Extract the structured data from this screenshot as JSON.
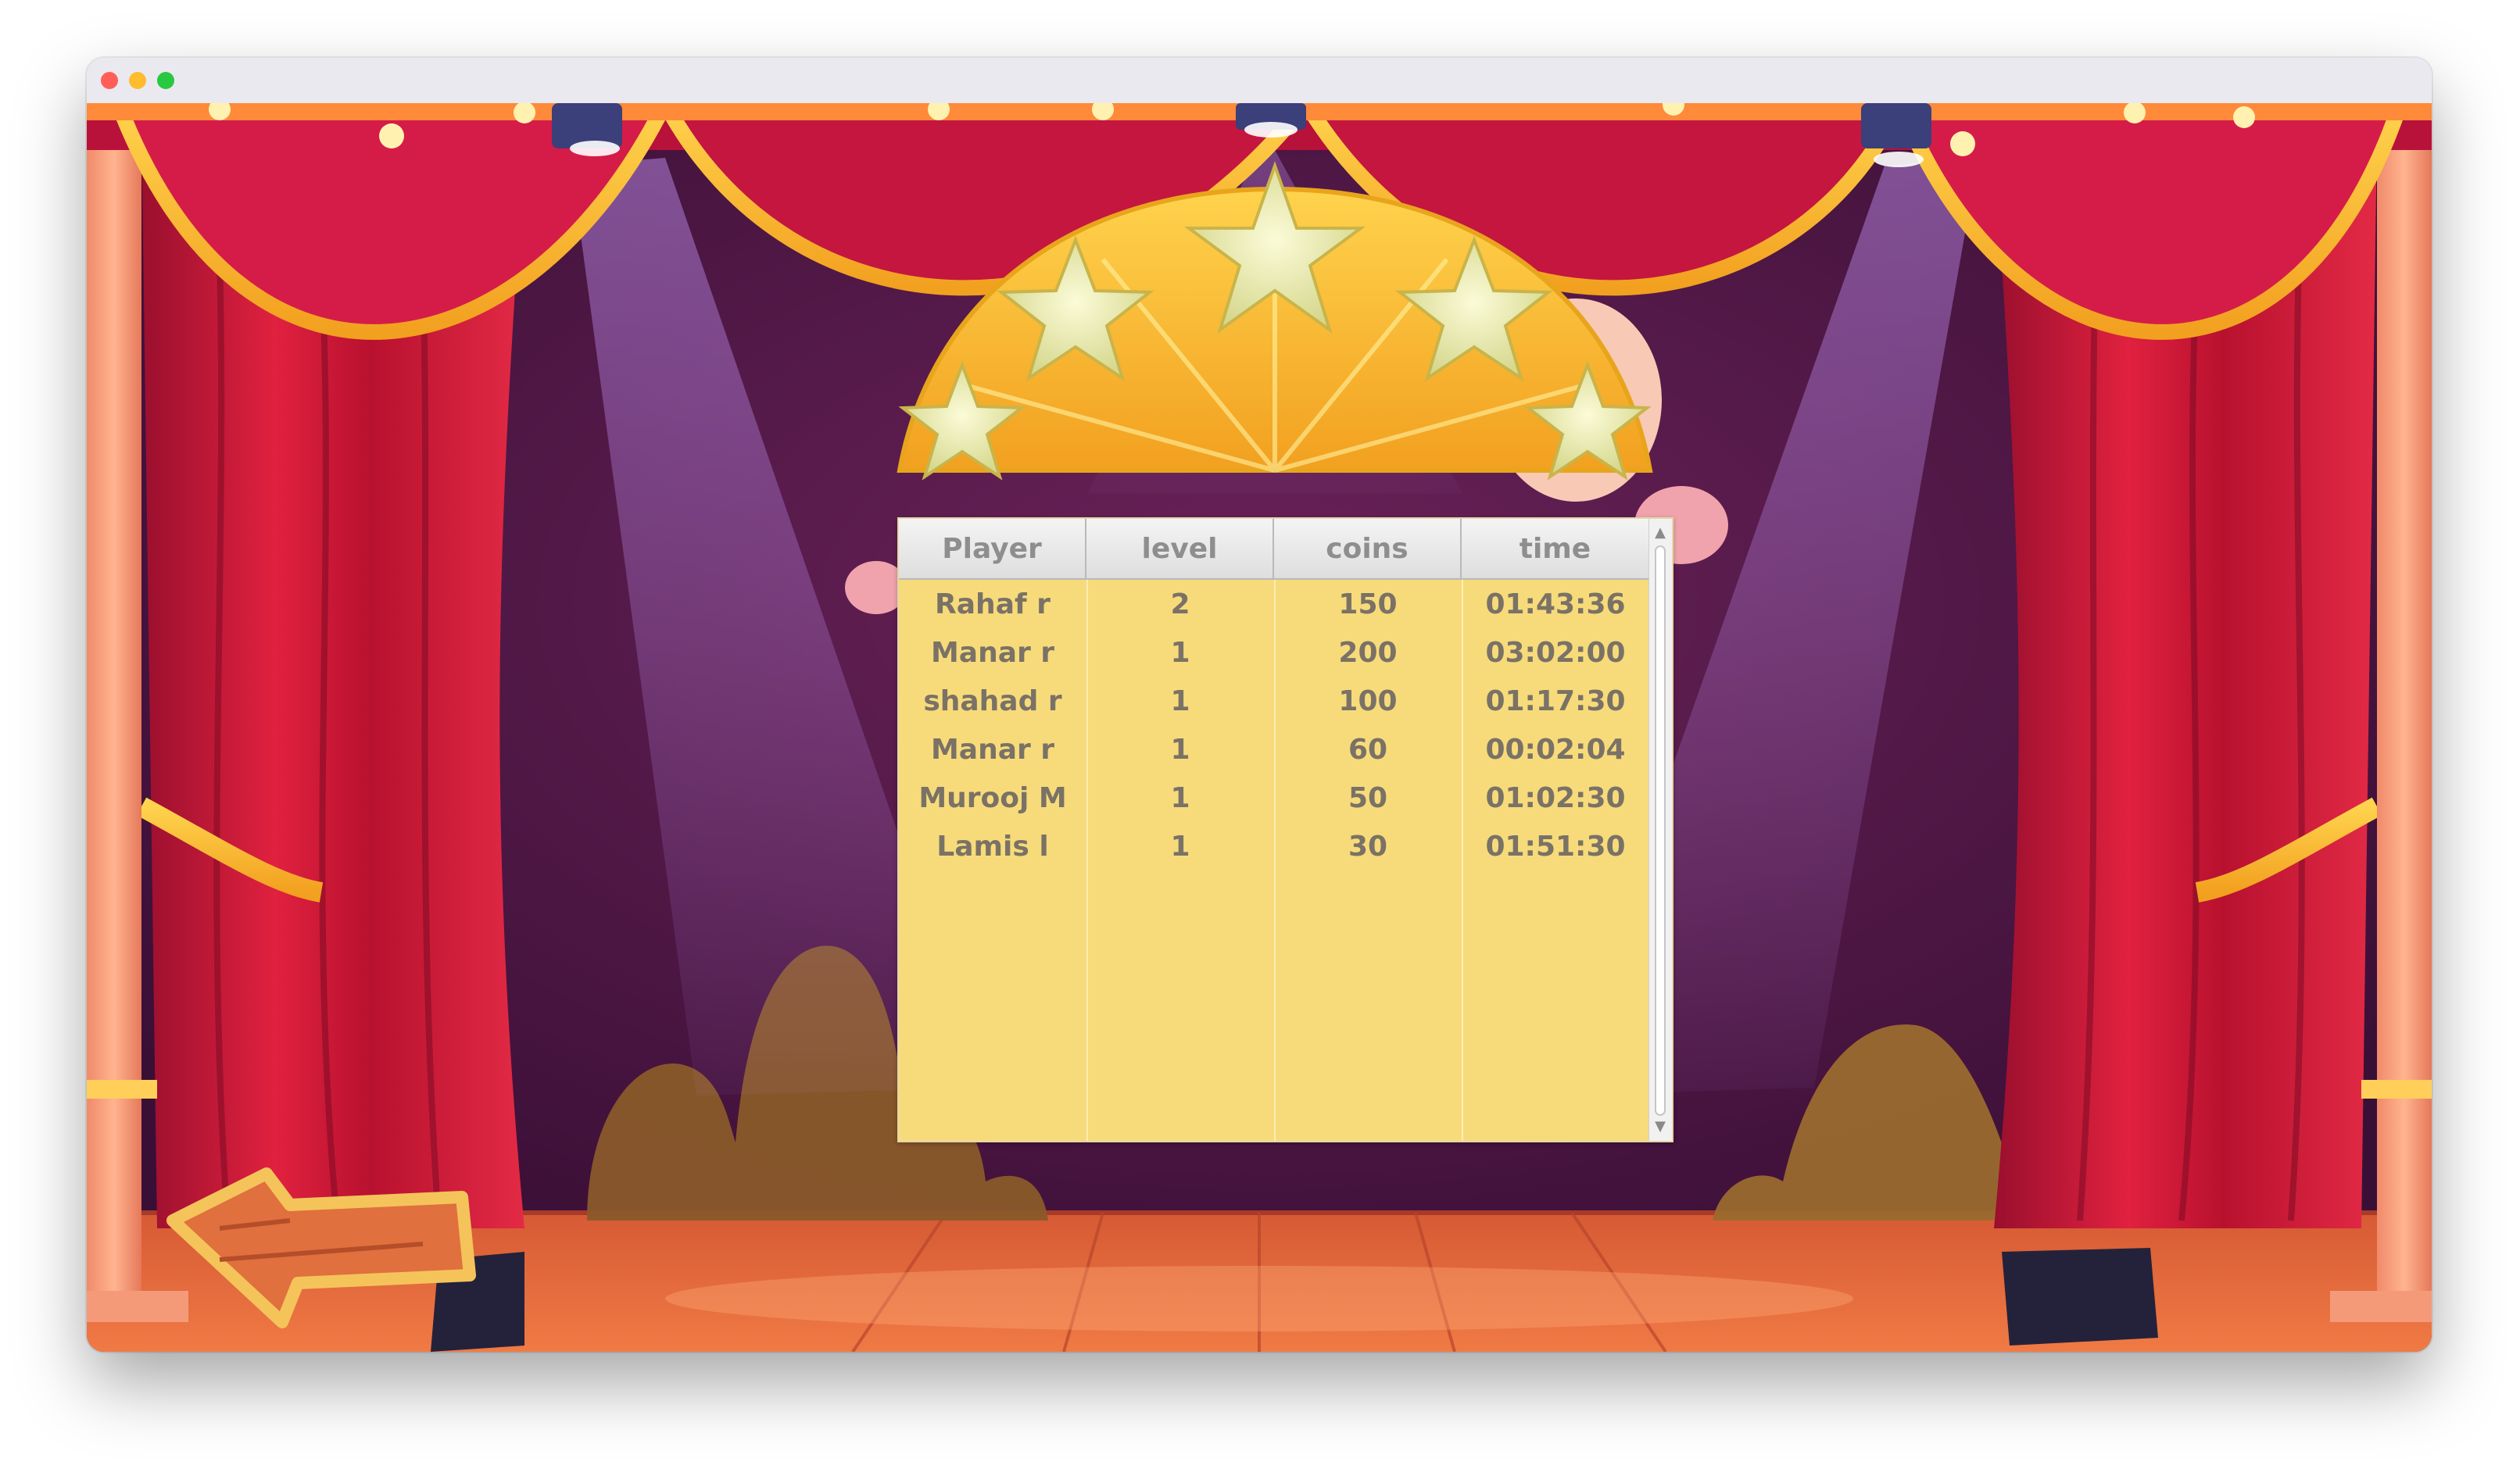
{
  "window": {
    "controls": [
      "close",
      "minimize",
      "zoom"
    ]
  },
  "leaderboard": {
    "headers": {
      "player": "Player",
      "level": "level",
      "coins": "coins",
      "time": "time"
    },
    "rows": [
      {
        "player": "Rahaf r",
        "level": "2",
        "coins": "150",
        "time": "01:43:36"
      },
      {
        "player": "Manar r",
        "level": "1",
        "coins": "200",
        "time": "03:02:00"
      },
      {
        "player": "shahad r",
        "level": "1",
        "coins": "100",
        "time": "01:17:30"
      },
      {
        "player": "Manar r",
        "level": "1",
        "coins": "60",
        "time": "00:02:04"
      },
      {
        "player": "Murooj M",
        "level": "1",
        "coins": "50",
        "time": "01:02:30"
      },
      {
        "player": "Lamis l",
        "level": "1",
        "coins": "30",
        "time": "01:51:30"
      }
    ]
  },
  "scene": {
    "icons": {
      "back": "back-arrow-sign-icon",
      "stars": "stars-crown-icon"
    },
    "colors": {
      "curtain": "#c8163f",
      "backdrop": "#5a1a4e",
      "floor": "#e8683a",
      "board": "#f7db7a",
      "gold": "#f5b52a"
    }
  }
}
